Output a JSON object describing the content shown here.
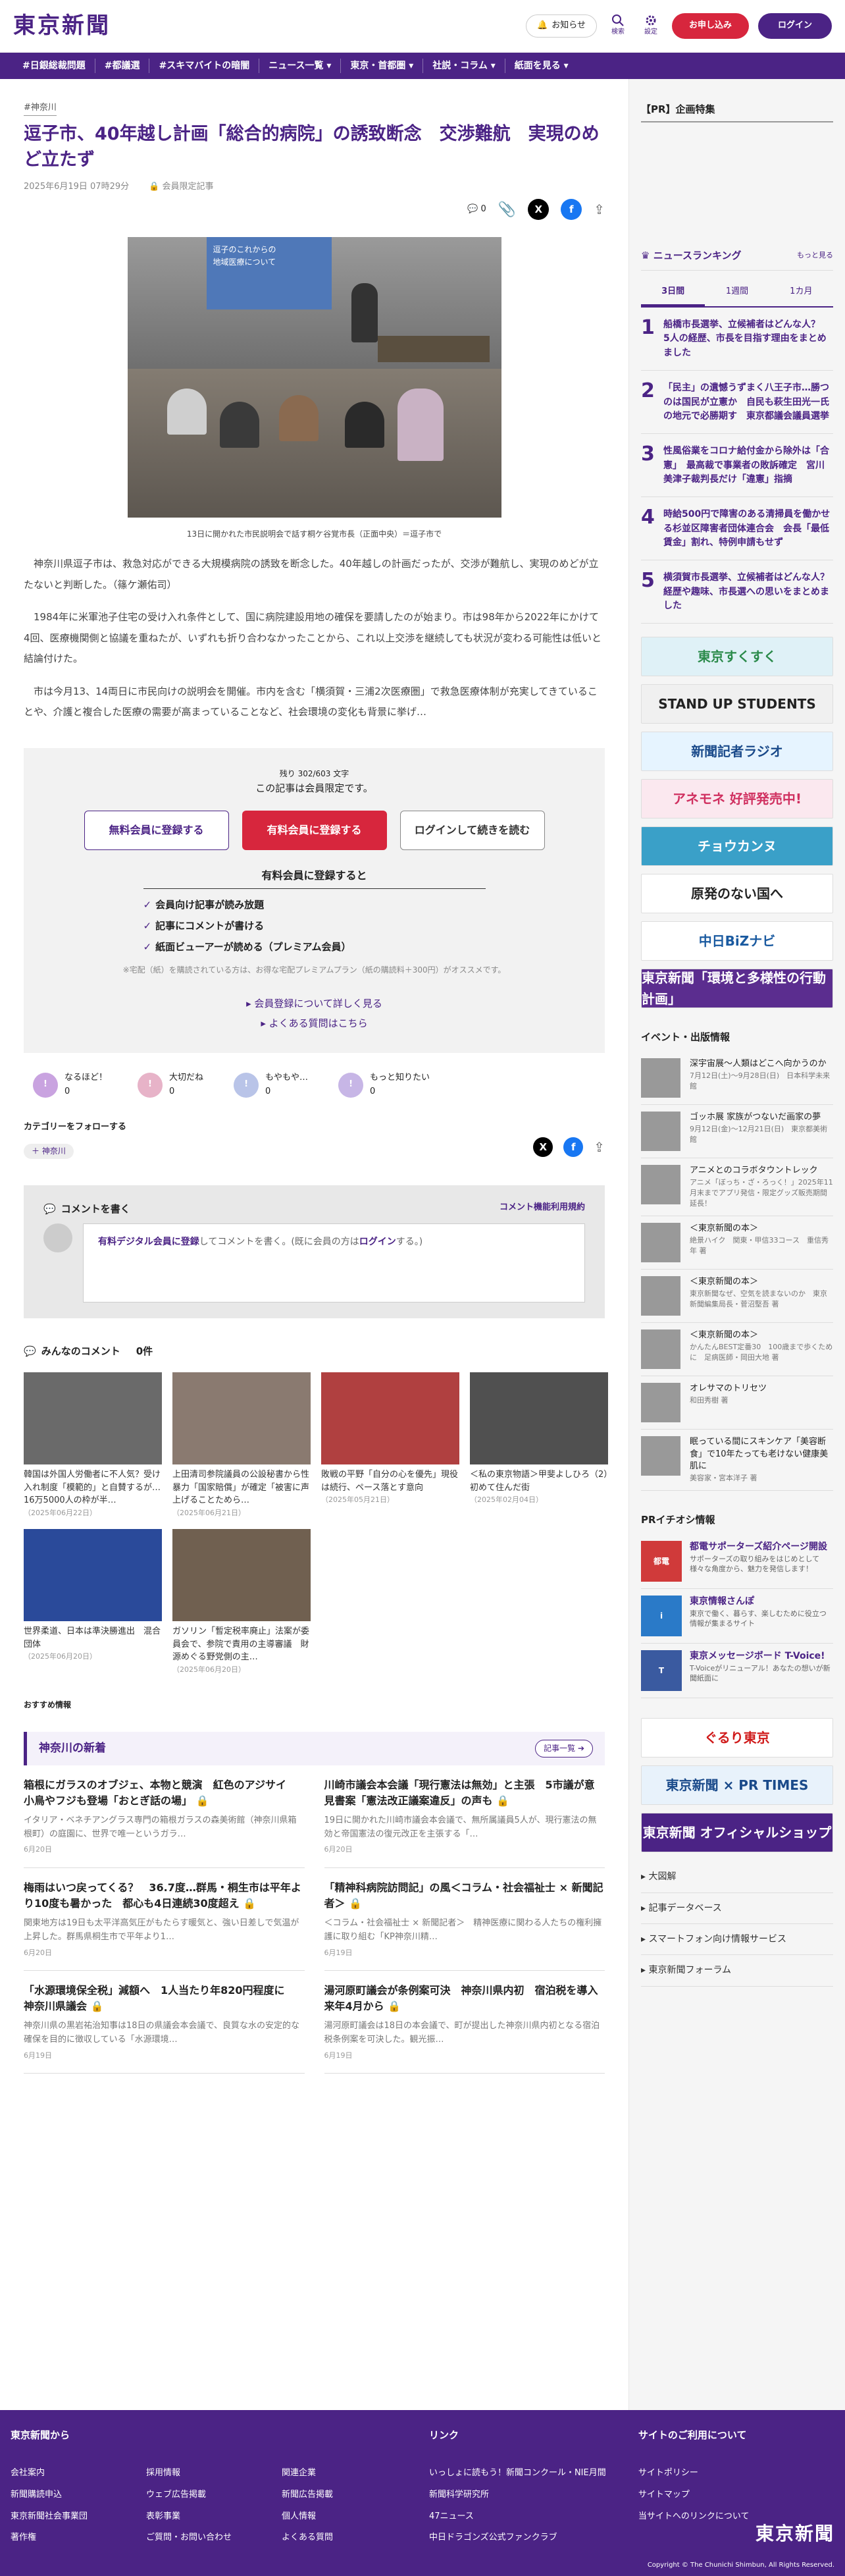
{
  "header": {
    "logo": "東京新聞",
    "notify": "お知らせ",
    "search": "検索",
    "settings": "設定",
    "subscribe": "お申し込み",
    "login": "ログイン"
  },
  "nav": [
    "#日銀総裁問題",
    "#都議選",
    "#スキマバイトの暗闇",
    "ニュース一覧 ▾",
    "東京・首都圏 ▾",
    "社説・コラム ▾",
    "紙面を見る ▾"
  ],
  "article": {
    "tag": "#神奈川",
    "title": "逗子市、40年越し計画「総合的病院」の誘致断念　交渉難航　実現のめど立たず",
    "date": "2025年6月19日 07時29分",
    "members_only": "会員限定記事",
    "comment_count": "0",
    "photo_screen_text": "逗子のこれからの\n地域医療について",
    "caption": "13日に開かれた市民説明会で話す桐ケ谷覚市長（正面中央）＝逗子市で",
    "paragraphs": [
      "神奈川県逗子市は、救急対応ができる大規模病院の誘致を断念した。40年越しの計画だったが、交渉が難航し、実現のめどが立たないと判断した。（篠ケ瀬佑司）",
      "1984年に米軍池子住宅の受け入れ条件として、国に病院建設用地の確保を要請したのが始まり。市は98年から2022年にかけて4回、医療機関側と協議を重ねたが、いずれも折り合わなかったことから、これ以上交渉を継続しても状況が変わる可能性は低いと結論付けた。",
      "市は今月13、14両日に市民向けの説明会を開催。市内を含む「横須賀・三浦2次医療圏」で救急医療体制が充実してきていることや、介護と複合した医療の需要が高まっていることなど、社会環境の変化も背景に挙げ…"
    ]
  },
  "paywall": {
    "remaining": "残り 302/603 文字",
    "message": "この記事は会員限定です。",
    "btn_free": "無料会員に登録する",
    "btn_paid": "有料会員に登録する",
    "btn_login": "ログインして続きを読む",
    "benefits_title": "有料会員に登録すると",
    "benefits": [
      "会員向け記事が読み放題",
      "記事にコメントが書ける",
      "紙面ビューアーが読める（プレミアム会員）"
    ],
    "note": "※宅配（紙）を購読されている方は、お得な宅配プレミアムプラン（紙の購読料＋300円）がオススメです。",
    "link1": "会員登録について詳しく見る",
    "link2": "よくある質問はこちら"
  },
  "reactions": [
    {
      "label": "なるほど！",
      "count": "0",
      "color": "#c9a3e0"
    },
    {
      "label": "大切だね",
      "count": "0",
      "color": "#e7b3c8"
    },
    {
      "label": "もやもや…",
      "count": "0",
      "color": "#b9c4e8"
    },
    {
      "label": "もっと知りたい",
      "count": "0",
      "color": "#c7b6e6"
    }
  ],
  "follow": {
    "title": "カテゴリーをフォローする",
    "chip": "神奈川"
  },
  "comment": {
    "write": "コメントを書く",
    "rules": "コメント機能利用規約",
    "prompt_a": "有料デジタル会員に登録",
    "prompt_b": "してコメントを書く。(既に会員の方は",
    "prompt_c": "ログイン",
    "prompt_d": "する。)"
  },
  "all_comments": {
    "title": "みんなのコメント",
    "count": "0件"
  },
  "related": [
    {
      "title": "韓国は外国人労働者に不人気？受け入れ制度「模範的」と自賛するが…16万5000人の枠が半…",
      "date": "（2025年06月22日）",
      "tone": "#6a6a6a"
    },
    {
      "title": "上田清司参院議員の公設秘書から性暴力「国家賠償」が確定「被害に声上げることためら…",
      "date": "（2025年06月21日）",
      "tone": "#8a7a70"
    },
    {
      "title": "敗戦の平野「自分の心を優先」現役は続行、ペース落とす意向",
      "date": "（2025年05月21日）",
      "tone": "#b04040"
    },
    {
      "title": "＜私の東京物語＞甲斐よしひろ（2）　初めて住んだ街",
      "date": "（2025年02月04日）",
      "tone": "#505050"
    },
    {
      "title": "世界柔道、日本は準決勝進出　混合団体",
      "date": "（2025年06月20日）",
      "tone": "#2a4a9a"
    },
    {
      "title": "ガソリン「暫定税率廃止」法案が委員会で、参院で責用の主導審議　財源めぐる野党側の主…",
      "date": "（2025年06月20日）",
      "tone": "#706050"
    }
  ],
  "recommend": "おすすめ情報",
  "kanagawa": {
    "title": "神奈川の新着",
    "more": "記事一覧",
    "items": [
      {
        "title": "箱根にガラスのオブジェ、本物と競演　紅色のアジサイ　小鳥やフジも登場「おとぎ話の場」",
        "body": "イタリア・ベネチアングラス専門の箱根ガラスの森美術館（神奈川県箱根町）の庭園に、世界で唯一というガラ…",
        "date": "6月20日"
      },
      {
        "title": "川崎市議会本会議「現行憲法は無効」と主張　5市議が意見書案「憲法改正議案違反」の声も",
        "body": "19日に開かれた川崎市議会本会議で、無所属議員5人が、現行憲法の無効と帝国憲法の復元改正を主張する「…",
        "date": "6月20日"
      },
      {
        "title": "梅雨はいつ戻ってくる？　36.7度…群馬・桐生市は平年より10度も暑かった　都心も4日連続30度超え",
        "body": "関東地方は19日も太平洋高気圧がもたらす暖気と、強い日差しで気温が上昇した。群馬県桐生市で平年より1…",
        "date": "6月20日"
      },
      {
        "title": "「精神科病院訪問記」の風＜コラム・社会福祉士 × 新聞記者＞",
        "body": "＜コラム・社会福祉士 × 新聞記者＞　精神医療に関わる人たちの権利擁護に取り組む「KP神奈川精…",
        "date": "6月19日"
      },
      {
        "title": "「水源環境保全税」減額へ　1人当たり年820円程度に　神奈川県議会",
        "body": "神奈川県の黒岩祐治知事は18日の県議会本会議で、良質な水の安定的な確保を目的に徴収している「水源環境…",
        "date": "6月19日"
      },
      {
        "title": "湯河原町議会が条例案可決　神奈川県内初　宿泊税を導入　来年4月から",
        "body": "湯河原町議会は18日の本会議で、町が提出した神奈川県内初となる宿泊税条例案を可決した。観光振…",
        "date": "6月19日"
      }
    ]
  },
  "sidebar": {
    "pr_title": "【PR】企画特集",
    "ranking_title": "ニュースランキング",
    "ranking_more": "もっと見る",
    "tabs": [
      "3日間",
      "1週間",
      "1カ月"
    ],
    "ranks": [
      "船橋市長選挙、立候補者はどんな人？　5人の経歴、市長を目指す理由をまとめました",
      "「民主」の遺憾うずまく八王子市…勝つのは国民が立憲か　自民も萩生田光一氏の地元で必勝期す　東京都議会議員選挙",
      "性風俗業をコロナ給付金から除外は「合憲」　最高裁で事業者の敗訴確定　宮川美津子裁判長だけ「違憲」指摘",
      "時給500円で障害のある清掃員を働かせる杉並区障害者団体連合会　会長「最低賃金」割れ、特例申請もせず",
      "横須賀市長選挙、立候補者はどんな人？　経歴や趣味、市長選への思いをまとめました"
    ],
    "banners": [
      {
        "text": "東京すくすく",
        "bg": "#dff1f7",
        "fg": "#2a8a4a"
      },
      {
        "text": "STAND UP STUDENTS",
        "bg": "#f0f0f0",
        "fg": "#222"
      },
      {
        "text": "新聞記者ラジオ",
        "bg": "#e6f4ff",
        "fg": "#1a4a8a"
      },
      {
        "text": "アネモネ 好評発売中!",
        "bg": "#fbe8ef",
        "fg": "#d03060"
      },
      {
        "text": "チョウカンヌ",
        "bg": "#3aa0c8",
        "fg": "#fff"
      },
      {
        "text": "原発のない国へ",
        "bg": "#fff",
        "fg": "#222"
      },
      {
        "text": "中日BiZナビ",
        "bg": "#fff",
        "fg": "#1a5aa0"
      },
      {
        "text": "東京新聞「環境と多様性の行動計画」",
        "bg": "#5b2d8f",
        "fg": "#fff"
      }
    ],
    "events_title": "イベント・出版情報",
    "events": [
      {
        "t": "深宇宙展〜人類はどこへ向かうのか",
        "s": "7月12日(土)〜9月28日(日)　日本科学未来館"
      },
      {
        "t": "ゴッホ展 家族がつないだ画家の夢",
        "s": "9月12日(金)〜12月21日(日)　東京都美術館"
      },
      {
        "t": "アニメとのコラボタウントレック",
        "s": "アニメ「ぼっち・ざ・ろっく！」2025年11月末までアプリ発信・限定グッズ販売期間延長！"
      },
      {
        "t": "＜東京新聞の本＞",
        "s": "絶景ハイク　関東・甲信33コース　重信秀年 著"
      },
      {
        "t": "＜東京新聞の本＞",
        "s": "東京新聞なぜ、空気を読まないのか　東京新聞編集局長・菅沼堅吾 著"
      },
      {
        "t": "＜東京新聞の本＞",
        "s": "かんたんBEST定番30　100歳まで歩くために　足病医師・岡田大地 著"
      },
      {
        "t": "オレサマのトリセツ",
        "s": "和田秀樹 著"
      },
      {
        "t": "眠っている間にスキンケア「美容断食」で10年たっても老けない健康美肌に",
        "s": "美容家・宮本洋子 著"
      }
    ],
    "pr_info_title": "PRイチオシ情報",
    "pr_info": [
      {
        "t": "都電サポーターズ紹介ページ開設",
        "s": "サポーターズの取り組みをはじめとして様々な角度から、魅力を発信します！",
        "bg": "#d03a3a",
        "icon": "都電"
      },
      {
        "t": "東京情報さんぽ",
        "s": "東京で働く、暮らす、楽しむために役立つ情報が集まるサイト",
        "bg": "#2a7ac8",
        "icon": "i"
      },
      {
        "t": "東京メッセージボード T-Voice!",
        "s": "T-Voiceがリニューアル！あなたの想いが新聞紙面に",
        "bg": "#3a5aa0",
        "icon": "T"
      }
    ],
    "banners2": [
      {
        "text": "ぐるり東京",
        "bg": "#fff",
        "fg": "#d01a1a"
      },
      {
        "text": "東京新聞 × PR TIMES",
        "bg": "#e8f2fb",
        "fg": "#1a4a8a"
      },
      {
        "text": "東京新聞 オフィシャルショップ",
        "bg": "#4b2385",
        "fg": "#fff"
      }
    ],
    "links": [
      "大図解",
      "記事データベース",
      "スマートフォン向け情報サービス",
      "東京新聞フォーラム"
    ]
  },
  "footer": {
    "c1_title": "東京新聞から",
    "c1": [
      "会社案内",
      "採用情報",
      "関連企業",
      "新聞購読申込",
      "ウェブ広告掲載",
      "新聞広告掲載",
      "東京新聞社会事業団",
      "表彰事業",
      "個人情報",
      "著作権",
      "ご質問・お問い合わせ",
      "よくある質問"
    ],
    "c2_title": "リンク",
    "c2": [
      "いっしょに読もう！新聞コンクール・NIE月間",
      "新聞科学研究所",
      "47ニュース",
      "中日ドラゴンズ公式ファンクラブ"
    ],
    "c3_title": "サイトのご利用について",
    "c3": [
      "サイトポリシー",
      "サイトマップ",
      "当サイトへのリンクについて"
    ],
    "logo": "東京新聞",
    "copyright": "Copyright © The Chunichi Shimbun, All Rights Reserved."
  }
}
